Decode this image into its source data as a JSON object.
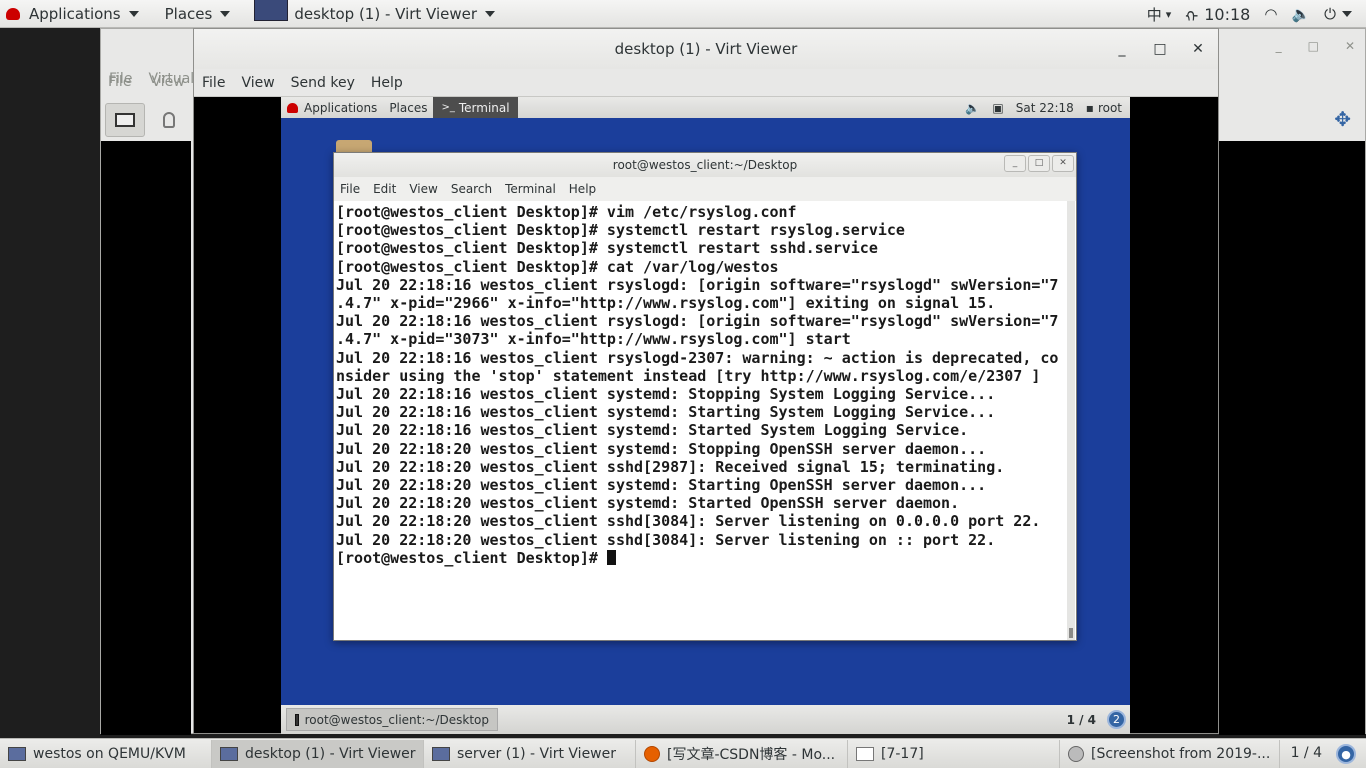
{
  "host_topbar": {
    "applications": "Applications",
    "places": "Places",
    "active_window": "desktop (1) - Virt Viewer",
    "input_method": "中",
    "time": "10:18"
  },
  "background_window": {
    "menu": [
      "File",
      "Virtual M"
    ]
  },
  "viewer": {
    "title": "desktop (1) - Virt Viewer",
    "menu": [
      "File",
      "View",
      "Send key",
      "Help"
    ],
    "bg_menu_behind": [
      "File",
      "View"
    ]
  },
  "guest": {
    "panel": {
      "applications": "Applications",
      "places": "Places",
      "task": "Terminal",
      "clock": "Sat 22:18",
      "user": "root"
    },
    "terminal": {
      "title": "root@westos_client:~/Desktop",
      "menu": [
        "File",
        "Edit",
        "View",
        "Search",
        "Terminal",
        "Help"
      ],
      "lines": [
        "[root@westos_client Desktop]# vim /etc/rsyslog.conf",
        "[root@westos_client Desktop]# systemctl restart rsyslog.service",
        "[root@westos_client Desktop]# systemctl restart sshd.service",
        "[root@westos_client Desktop]# cat /var/log/westos",
        "Jul 20 22:18:16 westos_client rsyslogd: [origin software=\"rsyslogd\" swVersion=\"7",
        ".4.7\" x-pid=\"2966\" x-info=\"http://www.rsyslog.com\"] exiting on signal 15.",
        "Jul 20 22:18:16 westos_client rsyslogd: [origin software=\"rsyslogd\" swVersion=\"7",
        ".4.7\" x-pid=\"3073\" x-info=\"http://www.rsyslog.com\"] start",
        "Jul 20 22:18:16 westos_client rsyslogd-2307: warning: ~ action is deprecated, co",
        "nsider using the 'stop' statement instead [try http://www.rsyslog.com/e/2307 ]",
        "Jul 20 22:18:16 westos_client systemd: Stopping System Logging Service...",
        "Jul 20 22:18:16 westos_client systemd: Starting System Logging Service...",
        "Jul 20 22:18:16 westos_client systemd: Started System Logging Service.",
        "Jul 20 22:18:20 westos_client systemd: Stopping OpenSSH server daemon...",
        "Jul 20 22:18:20 westos_client sshd[2987]: Received signal 15; terminating.",
        "Jul 20 22:18:20 westos_client systemd: Starting OpenSSH server daemon...",
        "Jul 20 22:18:20 westos_client systemd: Started OpenSSH server daemon.",
        "Jul 20 22:18:20 westos_client sshd[3084]: Server listening on 0.0.0.0 port 22.",
        "Jul 20 22:18:20 westos_client sshd[3084]: Server listening on :: port 22."
      ],
      "prompt": "[root@westos_client Desktop]# "
    },
    "bottom_task": "root@westos_client:~/Desktop",
    "pager": "1 / 4",
    "badge": "2"
  },
  "taskbar": {
    "items": [
      "westos on QEMU/KVM",
      "desktop (1) - Virt Viewer",
      "server (1) - Virt Viewer",
      "[写文章-CSDN博客 - Mo...",
      "[7-17]",
      "[Screenshot from 2019-..."
    ],
    "pager": "1 / 4"
  },
  "colors": {
    "guest_desktop": "#1b3e9b",
    "redhat_red": "#cc0000",
    "badge_blue": "#3465a4"
  }
}
